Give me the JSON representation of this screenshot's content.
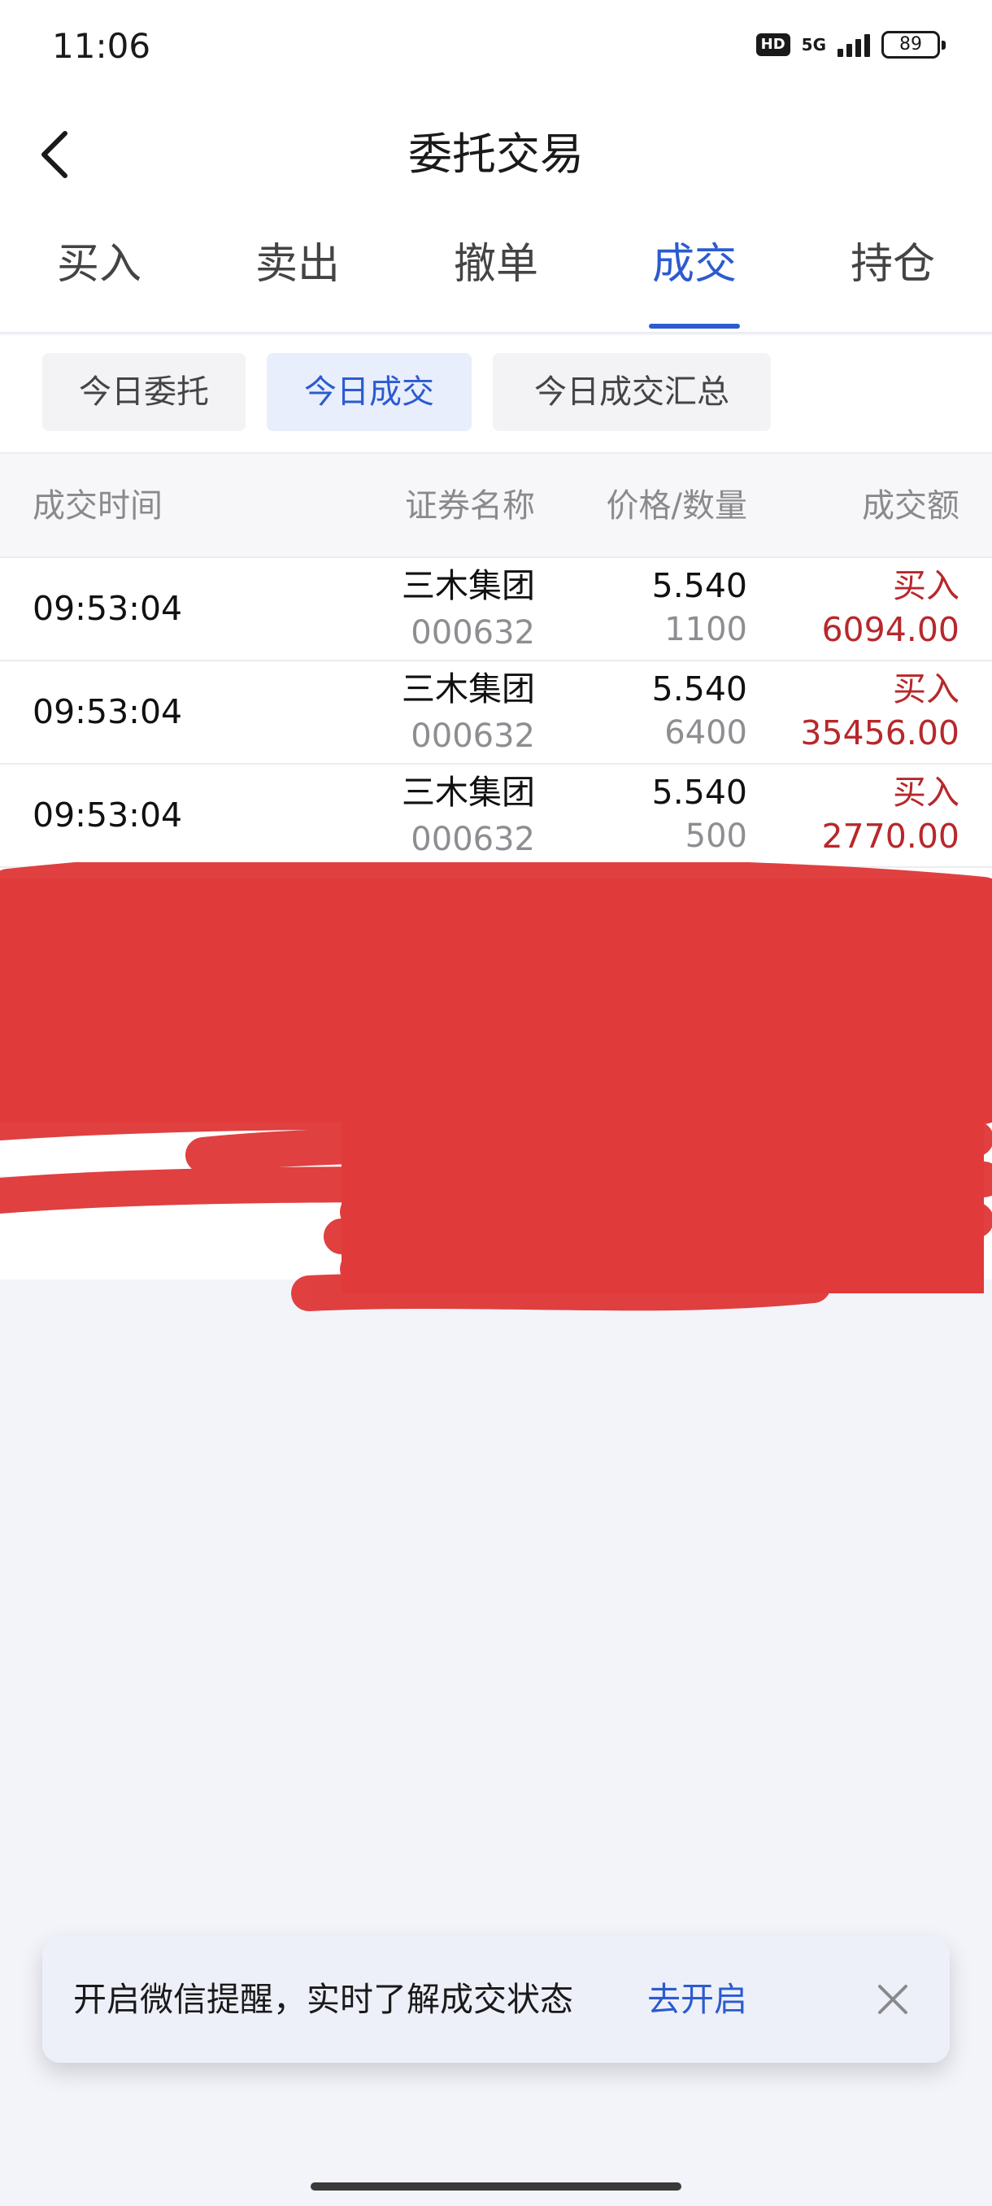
{
  "status_bar": {
    "time": "11:06",
    "hd_badge": "HD",
    "network": "5G",
    "battery": "89"
  },
  "header": {
    "back_icon": "chevron-left-icon",
    "title": "委托交易"
  },
  "tabs": [
    {
      "label": "买入",
      "active": false
    },
    {
      "label": "卖出",
      "active": false
    },
    {
      "label": "撤单",
      "active": false
    },
    {
      "label": "成交",
      "active": true
    },
    {
      "label": "持仓",
      "active": false
    }
  ],
  "filters": [
    {
      "label": "今日委托",
      "active": false
    },
    {
      "label": "今日成交",
      "active": true
    },
    {
      "label": "今日成交汇总",
      "active": false
    }
  ],
  "table": {
    "columns": [
      "成交时间",
      "证券名称",
      "价格/数量",
      "成交额"
    ],
    "rows": [
      {
        "time": "09:53:04",
        "name": "三木集团",
        "code": "000632",
        "price": "5.540",
        "qty": "1100",
        "side": "买入",
        "amount": "6094.00"
      },
      {
        "time": "09:53:04",
        "name": "三木集团",
        "code": "000632",
        "price": "5.540",
        "qty": "6400",
        "side": "买入",
        "amount": "35456.00"
      },
      {
        "time": "09:53:04",
        "name": "三木集团",
        "code": "000632",
        "price": "5.540",
        "qty": "500",
        "side": "买入",
        "amount": "2770.00"
      }
    ],
    "redacted_row_count": 4
  },
  "notice": {
    "text": "开启微信提醒，实时了解成交状态",
    "link": "去开启",
    "close_icon": "close-icon"
  },
  "colors": {
    "accent": "#2c5bd0",
    "buy_red": "#b7282c",
    "scribble_red": "#e03a3a",
    "background": "#f3f4fa"
  }
}
